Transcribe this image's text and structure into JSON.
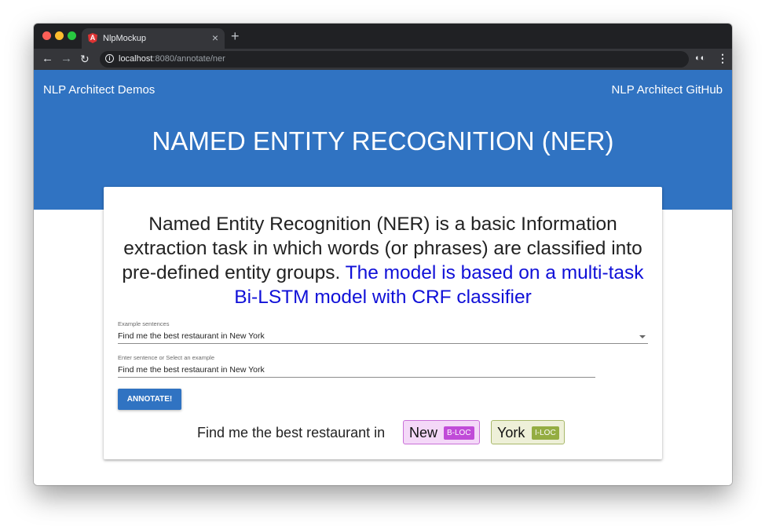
{
  "browser": {
    "tab_title": "NlpMockup",
    "favicon_letter": "A",
    "close_glyph": "×",
    "new_tab_glyph": "+",
    "url_host": "localhost",
    "url_path": ":8080/annotate/ner",
    "icons": {
      "back": "arrow-left",
      "forward": "arrow-right",
      "reload": "reload",
      "info": "info-circle",
      "star": "star",
      "incognito": "incognito",
      "menu": "vertical-dots"
    }
  },
  "header": {
    "brand": "NLP Architect Demos",
    "github_link": "NLP Architect GitHub",
    "title": "NAMED ENTITY RECOGNITION (NER)",
    "color": "#3073c2"
  },
  "card": {
    "description_plain": "Named Entity Recognition (NER) is a basic Information extraction task in which words (or phrases) are classified into pre-defined entity groups. ",
    "description_highlight": "The model is based on a multi-task Bi-LSTM model with CRF classifier",
    "example_select": {
      "label": "Example sentences",
      "value": "Find me the best restaurant in New York"
    },
    "sentence_input": {
      "label": "Enter sentence or Select an example",
      "value": "Find me the best restaurant in New York"
    },
    "annotate_button": "ANNOTATE!",
    "result": {
      "plain_text": "Find me the best restaurant in",
      "entities": [
        {
          "word": "New",
          "tag": "B-LOC",
          "color": "#c04bd8"
        },
        {
          "word": "York",
          "tag": "I-LOC",
          "color": "#94ad42"
        }
      ]
    }
  }
}
